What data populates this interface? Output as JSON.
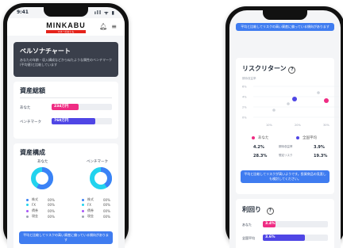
{
  "left_phone": {
    "status_time": "9:41",
    "status_icons": "ıll ᯤ ▮",
    "logo": {
      "main": "MINKABU",
      "sub": "マネーのおとも"
    },
    "persona": {
      "title": "ペルソナチャート",
      "description": "あなたの年齢・収入構成などから似たような属性のベンチマーク(平均値)と比較しています"
    },
    "assets": {
      "title": "資産総額",
      "rows": [
        {
          "label": "あなた",
          "value": "234万円",
          "fill": 0.45
        },
        {
          "label": "ベンチマーク",
          "value": "760万円",
          "fill": 0.72
        }
      ]
    },
    "composition": {
      "title": "資産構成",
      "columns": [
        "あなた",
        "ベンチマーク"
      ],
      "legend": [
        {
          "name": "株式",
          "value": "00%",
          "color": "#3b82f6"
        },
        {
          "name": "FX",
          "value": "00%",
          "color": "#22d3ee"
        },
        {
          "name": "債券",
          "value": "00%",
          "color": "#a855f7"
        },
        {
          "name": "現金",
          "value": "00%",
          "color": "#9ca3af"
        }
      ],
      "left_legend_count": 4
    },
    "banner": "平均と比較してリスクの高い資産に偏っている傾向があります"
  },
  "right_phone": {
    "banner_top": "平均と比較してリスクの高い資産に偏っている傾向があります",
    "risk_return": {
      "title": "リスクリターン",
      "ylabel": "期待収益率",
      "yticks": [
        "6%",
        "4%",
        "2%",
        "0%"
      ],
      "xticks": [
        "10%",
        "20%",
        "30%"
      ],
      "legend": [
        {
          "name": "あなた",
          "color": "#ef2c83"
        },
        {
          "name": "全国平均",
          "color": "#4f46e5"
        }
      ],
      "rows": [
        {
          "you": "4.2%",
          "label": "期待収益率",
          "avg": "3.9%"
        },
        {
          "you": "28.3%",
          "label": "想定リスク",
          "avg": "19.3%"
        }
      ]
    },
    "banner_mid": "平均と比較してリスクが高いようです。投資商品の見直しも検討してください。",
    "yield": {
      "title": "利回り",
      "rows": [
        {
          "label": "あなた",
          "value": "3.4%",
          "fill": 0.2
        },
        {
          "label": "全国平均",
          "value": "3.6%",
          "fill": 0.65
        }
      ]
    }
  }
}
